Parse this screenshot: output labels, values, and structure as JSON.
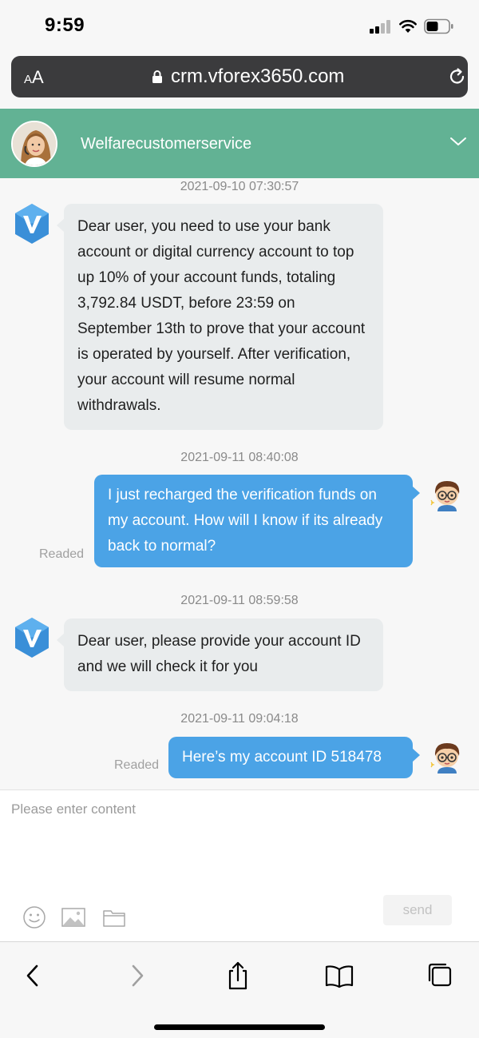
{
  "status_bar": {
    "time": "9:59"
  },
  "browser": {
    "aa_small": "A",
    "aa_large": "A",
    "url": "crm.vforex3650.com"
  },
  "chat_header": {
    "agent_name": "Welfarecustomerservice"
  },
  "messages": [
    {
      "timestamp": "2021-09-10 07:30:57",
      "sender": "agent",
      "text": "Dear user, you need to use your bank account or digital currency account to top up 10% of your account funds, totaling 3,792.84 USDT, before 23:59 on September 13th to prove that your account is operated by yourself. After verification, your account will resume normal withdrawals."
    },
    {
      "timestamp": "2021-09-11 08:40:08",
      "sender": "user",
      "text": "I just recharged the verification funds on my account. How will I know if its already back to normal?",
      "status": "Readed"
    },
    {
      "timestamp": "2021-09-11 08:59:58",
      "sender": "agent",
      "text": "Dear user, please provide your account ID and we will check it for you"
    },
    {
      "timestamp": "2021-09-11 09:04:18",
      "sender": "user",
      "text": "Here’s my account ID 518478",
      "status": "Readed"
    }
  ],
  "composer": {
    "placeholder": "Please enter content",
    "send_label": "send"
  },
  "colors": {
    "header": "#62b294",
    "user_bubble": "#4ba3e6",
    "agent_bubble": "#e9eced",
    "brand_logo": "#3a8fd8"
  },
  "icons": [
    "emoji-icon",
    "image-icon",
    "folder-icon",
    "back-icon",
    "forward-icon",
    "share-icon",
    "bookmarks-icon",
    "tabs-icon"
  ]
}
